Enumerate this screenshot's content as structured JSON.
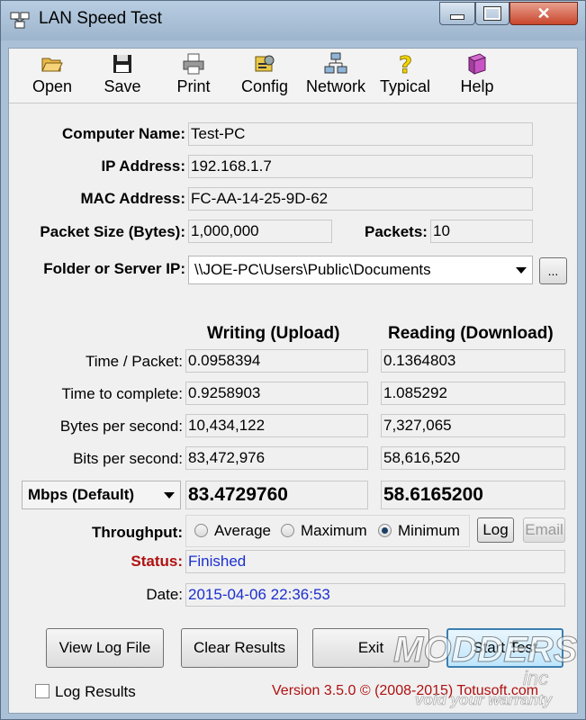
{
  "window": {
    "title": "LAN Speed Test"
  },
  "toolbar": [
    {
      "id": "open",
      "label": "Open",
      "icon": "open-folder-icon"
    },
    {
      "id": "save",
      "label": "Save",
      "icon": "floppy-disk-icon"
    },
    {
      "id": "print",
      "label": "Print",
      "icon": "printer-icon"
    },
    {
      "id": "config",
      "label": "Config",
      "icon": "config-icon"
    },
    {
      "id": "network",
      "label": "Network",
      "icon": "network-icon"
    },
    {
      "id": "typical",
      "label": "Typical",
      "icon": "question-icon"
    },
    {
      "id": "help",
      "label": "Help",
      "icon": "help-book-icon"
    }
  ],
  "info": {
    "computer_name_label": "Computer Name:",
    "computer_name": "Test-PC",
    "ip_label": "IP Address:",
    "ip": "192.168.1.7",
    "mac_label": "MAC Address:",
    "mac": "FC-AA-14-25-9D-62",
    "packet_size_label": "Packet Size (Bytes):",
    "packet_size": "1,000,000",
    "packets_label": "Packets:",
    "packets": "10",
    "folder_label": "Folder or Server IP:",
    "folder": "\\\\JOE-PC\\Users\\Public\\Documents",
    "browse_label": "..."
  },
  "results": {
    "writing_header": "Writing (Upload)",
    "reading_header": "Reading (Download)",
    "rows": [
      {
        "label": "Time / Packet:",
        "write": "0.0958394",
        "read": "0.1364803"
      },
      {
        "label": "Time to complete:",
        "write": "0.9258903",
        "read": "1.085292"
      },
      {
        "label": "Bytes per second:",
        "write": "10,434,122",
        "read": "7,327,065"
      },
      {
        "label": "Bits per second:",
        "write": "83,472,976",
        "read": "58,616,520"
      }
    ],
    "unit": "Mbps (Default)",
    "write_total": "83.4729760",
    "read_total": "58.6165200"
  },
  "throughput": {
    "label": "Throughput:",
    "options": [
      "Average",
      "Maximum",
      "Minimum"
    ],
    "selected": "Minimum",
    "log_label": "Log",
    "email_label": "Email"
  },
  "status": {
    "label": "Status:",
    "value": "Finished",
    "date_label": "Date:",
    "date": "2015-04-06 22:36:53"
  },
  "buttons": {
    "view_log": "View Log File",
    "clear": "Clear Results",
    "exit": "Exit",
    "start": "Start Test"
  },
  "footer": {
    "log_results": "Log Results",
    "version": "Version 3.5.0  ©  (2008-2015) Totusoft.com"
  },
  "watermark": {
    "line1": "MODDERS",
    "line2": "inc",
    "line3": "void your warranty"
  },
  "colors": {
    "status_label": "#b01010",
    "status_value": "#1b2fcf",
    "version": "#b01010",
    "title_bar": "#a9c0d6"
  }
}
